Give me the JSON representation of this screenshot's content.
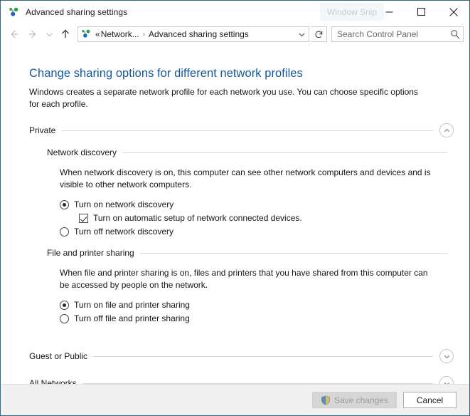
{
  "window": {
    "title": "Advanced sharing settings",
    "title_icon": "network-sharing-icon",
    "snip_overlay_text": "Window Snip",
    "minimize_label": "Minimize",
    "maximize_label": "Maximize",
    "close_label": "Close"
  },
  "nav": {
    "back_label": "Back",
    "forward_label": "Forward",
    "recent_label": "Recent locations",
    "up_label": "Up one level",
    "breadcrumb": {
      "icon": "network-sharing-icon",
      "separator_left": "«",
      "parent": "Network...",
      "separator": "›",
      "current": "Advanced sharing settings"
    },
    "address_dropdown_label": "Previous locations",
    "refresh_label": "Refresh",
    "search": {
      "placeholder": "Search Control Panel",
      "value": ""
    }
  },
  "main": {
    "heading": "Change sharing options for different network profiles",
    "description": "Windows creates a separate network profile for each network you use. You can choose specific options for each profile.",
    "sections": [
      {
        "name": "Private",
        "expanded": true,
        "toggle_icon": "chevron-up-icon",
        "subsections": [
          {
            "name": "Network discovery",
            "description": "When network discovery is on, this computer can see other network computers and devices and is visible to other network computers.",
            "options": [
              {
                "type": "radio",
                "label": "Turn on network discovery",
                "checked": true,
                "indented": false
              },
              {
                "type": "checkbox",
                "label": "Turn on automatic setup of network connected devices.",
                "checked": true,
                "indented": true
              },
              {
                "type": "radio",
                "label": "Turn off network discovery",
                "checked": false,
                "indented": false
              }
            ]
          },
          {
            "name": "File and printer sharing",
            "description": "When file and printer sharing is on, files and printers that you have shared from this computer can be accessed by people on the network.",
            "options": [
              {
                "type": "radio",
                "label": "Turn on file and printer sharing",
                "checked": true,
                "indented": false
              },
              {
                "type": "radio",
                "label": "Turn off file and printer sharing",
                "checked": false,
                "indented": false
              }
            ]
          }
        ]
      },
      {
        "name": "Guest or Public",
        "expanded": false,
        "toggle_icon": "chevron-down-icon",
        "subsections": []
      },
      {
        "name": "All Networks",
        "expanded": false,
        "toggle_icon": "chevron-down-icon",
        "subsections": []
      }
    ]
  },
  "footer": {
    "save_label": "Save changes",
    "save_disabled": true,
    "save_icon": "uac-shield-icon",
    "cancel_label": "Cancel"
  },
  "colors": {
    "window_border": "#2a6d8a",
    "heading": "#14579b",
    "footer_bg": "#f0f0f0",
    "rule": "#d8d8d8",
    "disabled_text": "#9a9a9a"
  }
}
